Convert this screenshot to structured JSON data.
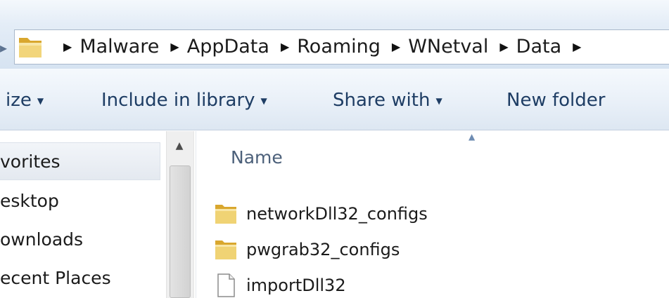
{
  "address_bar": {
    "breadcrumbs": [
      "Malware",
      "AppData",
      "Roaming",
      "WNetval",
      "Data"
    ]
  },
  "toolbar": {
    "organize_label": "ize",
    "include_label": "Include in library",
    "share_label": "Share with",
    "new_folder_label": "New folder"
  },
  "nav_pane": {
    "items": [
      {
        "label": "vorites"
      },
      {
        "label": "esktop"
      },
      {
        "label": "ownloads"
      },
      {
        "label": "ecent Places"
      }
    ]
  },
  "content": {
    "column_header": "Name",
    "files": [
      {
        "name": "networkDll32_configs",
        "type": "folder"
      },
      {
        "name": "pwgrab32_configs",
        "type": "folder"
      },
      {
        "name": "importDll32",
        "type": "file"
      }
    ]
  },
  "colors": {
    "toolbar_text": "#1e3d64",
    "folder_yellow": "#e8c25a",
    "header_text": "#4c607a"
  }
}
